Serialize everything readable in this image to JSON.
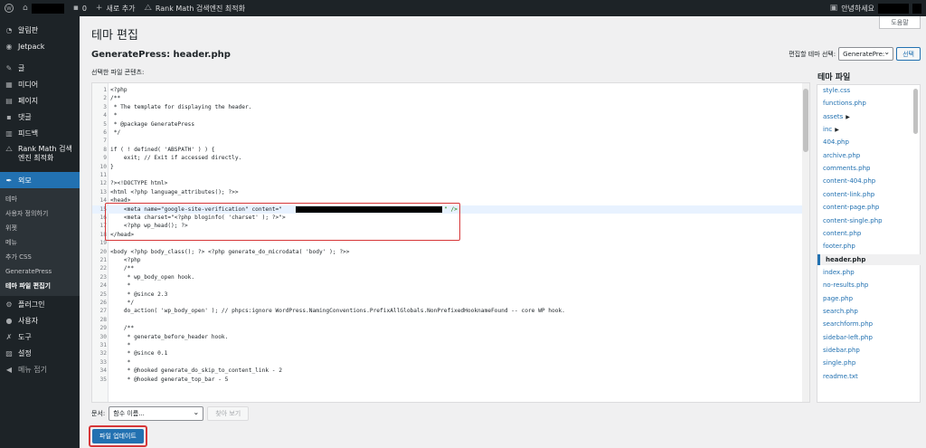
{
  "admin_bar": {
    "wp_logo": "wordpress-icon",
    "site_name_redacted": true,
    "comments_count": "0",
    "new_label": "새로 추가",
    "rankmath_label": "Rank Math 검색엔진 최적화",
    "greeting": "안녕하세요"
  },
  "sidebar": {
    "items": [
      {
        "label": "알림판",
        "icon": "dashboard-icon"
      },
      {
        "label": "Jetpack",
        "icon": "jetpack-icon"
      },
      {
        "label": "글",
        "icon": "pin-icon"
      },
      {
        "label": "미디어",
        "icon": "media-icon"
      },
      {
        "label": "페이지",
        "icon": "page-icon"
      },
      {
        "label": "댓글",
        "icon": "comment-icon"
      },
      {
        "label": "피드백",
        "icon": "feedback-icon"
      },
      {
        "label": "Rank Math 검색엔진 최적화",
        "icon": "rankmath-icon"
      },
      {
        "label": "외모",
        "icon": "appearance-icon"
      },
      {
        "label": "플러그인",
        "icon": "plugin-icon"
      },
      {
        "label": "사용자",
        "icon": "user-icon"
      },
      {
        "label": "도구",
        "icon": "tools-icon"
      },
      {
        "label": "설정",
        "icon": "settings-icon"
      },
      {
        "label": "메뉴 접기",
        "icon": "collapse-icon"
      }
    ],
    "submenu": [
      "테마",
      "사용자 정의하기",
      "위젯",
      "메뉴",
      "추가 CSS",
      "GeneratePress",
      "테마 파일 편집기"
    ]
  },
  "help_button": "도움말",
  "page_title": "테마 편집",
  "file_title": "GeneratePress: header.php",
  "theme_select": {
    "label": "편집할 테마 선택:",
    "value": "GeneratePre:",
    "button": "선택"
  },
  "content_label": "선택한 파일 콘텐츠:",
  "code_lines": [
    "<?php",
    "/**",
    " * The template for displaying the header.",
    " *",
    " * @package GeneratePress",
    " */",
    "",
    "if ( ! defined( 'ABSPATH' ) ) {",
    "    exit; // Exit if accessed directly.",
    "}",
    "",
    "?><!DOCTYPE html>",
    "<html <?php language_attributes(); ?>>",
    "<head>",
    "    <meta name=\"google-site-verification\" content=\"",
    "    <meta charset=\"<?php bloginfo( 'charset' ); ?>\">",
    "    <?php wp_head(); ?>",
    "</head>",
    "",
    "<body <?php body_class(); ?> <?php generate_do_microdata( 'body' ); ?>>",
    "    <?php",
    "    /**",
    "     * wp_body_open hook.",
    "     *",
    "     * @since 2.3",
    "     */",
    "    do_action( 'wp_body_open' ); // phpcs:ignore WordPress.NamingConventions.PrefixAllGlobals.NonPrefixedHooknameFound -- core WP hook.",
    "",
    "    /**",
    "     * generate_before_header hook.",
    "     *",
    "     * @since 0.1",
    "     *",
    "     * @hooked generate_do_skip_to_content_link - 2",
    "     * @hooked generate_top_bar - 5"
  ],
  "files_heading": "테마 파일",
  "files": [
    "style.css",
    "functions.php",
    "assets",
    "inc",
    "404.php",
    "archive.php",
    "comments.php",
    "content-404.php",
    "content-link.php",
    "content-page.php",
    "content-single.php",
    "content.php",
    "footer.php",
    "header.php",
    "index.php",
    "no-results.php",
    "page.php",
    "search.php",
    "searchform.php",
    "sidebar-left.php",
    "sidebar.php",
    "single.php",
    "readme.txt"
  ],
  "docs": {
    "label": "문서:",
    "select_value": "함수 이름...",
    "button": "찾아 보기"
  },
  "update_button": "파일 업데이트"
}
